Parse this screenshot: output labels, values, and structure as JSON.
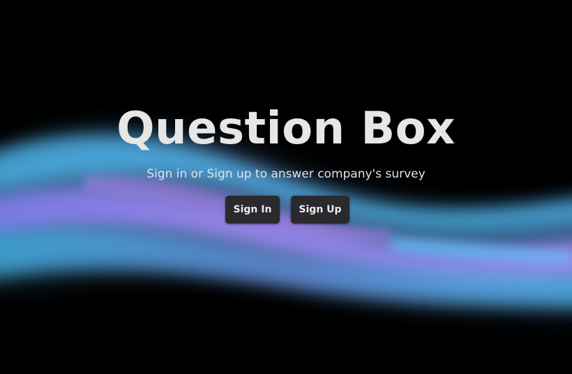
{
  "hero": {
    "title": "Question Box",
    "subtitle": "Sign in or Sign up to answer company's survey"
  },
  "actions": {
    "sign_in_label": "Sign In",
    "sign_up_label": "Sign Up"
  },
  "colors": {
    "background": "#000000",
    "button_background": "#2a2a2e",
    "wave_cyan": "#4fc3f7",
    "wave_violet": "#a78bfa",
    "wave_blue": "#60a5fa",
    "wave_magenta": "#c084fc"
  }
}
